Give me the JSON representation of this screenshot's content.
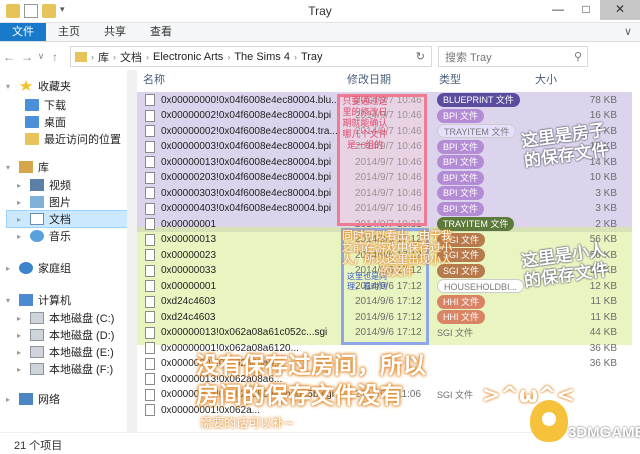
{
  "window": {
    "title": "Tray",
    "controls": [
      "—",
      "□",
      "✕"
    ]
  },
  "ribbon": {
    "tabs": [
      "文件",
      "主页",
      "共享",
      "查看"
    ],
    "expand": "∨"
  },
  "nav": {
    "back": "←",
    "forward": "→",
    "recent": "∨",
    "up": "↑"
  },
  "address": {
    "crumbs": [
      "库",
      "文档",
      "Electronic Arts",
      "The Sims 4",
      "Tray"
    ]
  },
  "search": {
    "placeholder": "搜索 Tray"
  },
  "sidebar": {
    "favorites": "收藏夹",
    "downloads": "下载",
    "desktop": "桌面",
    "recent": "最近访问的位置",
    "libraries": "库",
    "videos": "视频",
    "pictures": "图片",
    "documents": "文档",
    "music": "音乐",
    "homegroup": "家庭组",
    "computer": "计算机",
    "drive_c": "本地磁盘 (C:)",
    "drive_d": "本地磁盘 (D:)",
    "drive_e": "本地磁盘 (E:)",
    "drive_f": "本地磁盘 (F:)",
    "network": "网络"
  },
  "columns": {
    "name": "名称",
    "date": "修改日期",
    "type": "类型",
    "size": "大小"
  },
  "files": [
    {
      "name": "0x00000000!0x04f6008e4ec80004.blu...",
      "date": "2014/9/7 10:46",
      "type": "BLUEPRINT 文件",
      "size": "78 KB",
      "pill": "#5b4c9e"
    },
    {
      "name": "0x00000002!0x04f6008e4ec80004.bpi",
      "date": "2014/9/7 10:46",
      "type": "BPI 文件",
      "size": "16 KB",
      "pill": "#b48cd6"
    },
    {
      "name": "0x00000002!0x04f6008e4ec80004.tra...",
      "date": "2014/9/7 10:46",
      "type": "TRAYITEM 文件",
      "size": "2 KB",
      "pill": "#e7defc"
    },
    {
      "name": "0x00000003!0x04f6008e4ec80004.bpi",
      "date": "2014/9/7 10:46",
      "type": "BPI 文件",
      "size": "15 KB",
      "pill": "#b48cd6"
    },
    {
      "name": "0x00000013!0x04f6008e4ec80004.bpi",
      "date": "2014/9/7 10:46",
      "type": "BPI 文件",
      "size": "14 KB",
      "pill": "#b48cd6"
    },
    {
      "name": "0x00000203!0x04f6008e4ec80004.bpi",
      "date": "2014/9/7 10:46",
      "type": "BPI 文件",
      "size": "10 KB",
      "pill": "#b48cd6"
    },
    {
      "name": "0x00000303!0x04f6008e4ec80004.bpi",
      "date": "2014/9/7 10:46",
      "type": "BPI 文件",
      "size": "3 KB",
      "pill": "#b48cd6"
    },
    {
      "name": "0x00000403!0x04f6008e4ec80004.bpi",
      "date": "2014/9/7 10:46",
      "type": "BPI 文件",
      "size": "3 KB",
      "pill": "#b48cd6"
    },
    {
      "name": "0x00000001",
      "date": "2014/9/7 10:31",
      "type": "TRAYITEM 文件",
      "size": "2 KB",
      "pill": "#5d7a3c"
    },
    {
      "name": "0x00000013",
      "date": "2014/9/6 17:12",
      "type": "SGI 文件",
      "size": "56 KB",
      "pill": "#b77a4d"
    },
    {
      "name": "0x00000023",
      "date": "2014/9/6 17:12",
      "type": "SGI 文件",
      "size": "56 KB",
      "pill": "#b77a4d"
    },
    {
      "name": "0x00000033",
      "date": "2014/9/6 17:12",
      "type": "SGI 文件",
      "size": "53 KB",
      "pill": "#b77a4d"
    },
    {
      "name": "0x00000001",
      "date": "2014/9/6 17:12",
      "type": "HOUSEHOLDBI...",
      "size": "12 KB",
      "pill": "#ffffff"
    },
    {
      "name": "0xd24c4603",
      "date": "2014/9/6 17:12",
      "type": "HHI 文件",
      "size": "11 KB",
      "pill": "#d98464"
    },
    {
      "name": "0xd24c4603",
      "date": "2014/9/6 17:12",
      "type": "HHI 文件",
      "size": "11 KB",
      "pill": "#d98464"
    },
    {
      "name": "0x00000013!0x062a08a61c052c...sgi",
      "date": "2014/9/6 17:12",
      "type": "SGI 文件",
      "size": "44 KB",
      "pill": ""
    },
    {
      "name": "0x00000001!0x062a08a6120...",
      "date": "",
      "type": "",
      "size": "36 KB",
      "pill": ""
    },
    {
      "name": "0x00000001!0x062a08a6...",
      "date": "",
      "type": "",
      "size": "36 KB",
      "pill": ""
    },
    {
      "name": "0x00000013!0x062a08a6...",
      "date": "",
      "type": "",
      "size": "",
      "pill": ""
    },
    {
      "name": "0x00000023!0x062a080a60bd035b.sgi",
      "date": "2014/9/4 11:06",
      "type": "SGI 文件",
      "size": "",
      "pill": ""
    },
    {
      "name": "0x00000001!0x062a...",
      "date": "",
      "type": "",
      "size": "",
      "pill": ""
    }
  ],
  "annotations": {
    "red_box": "只要通过这里的修改日期就能确认哪几个文件是一组的",
    "blue_box": "这里也是同理，看时间",
    "left_green": "同时可以看出，由于我之前在游戏中保存过小人，所以这里出现小人的文件",
    "right_purple": "这里是房子的保存文件",
    "right_green": "这里是小人的保存文件",
    "bottom_line1": "没有保存过房间，所以",
    "bottom_line2": "房间的保存文件没有",
    "bottom_emote": ">^ω^<",
    "bottom_small": "需要的话可以补~"
  },
  "status": {
    "count": "21 个项目"
  },
  "watermark": {
    "text": "3DMGAME"
  }
}
